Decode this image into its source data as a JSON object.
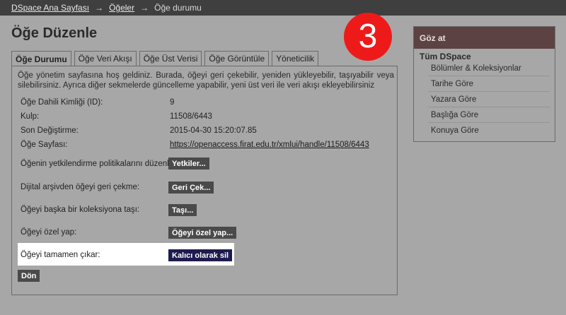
{
  "breadcrumb": {
    "home": "DSpace Ana Sayfası",
    "items": "Öğeler",
    "current": "Öğe durumu",
    "separator": "→"
  },
  "page_title": "Öğe Düzenle",
  "step_badge": "3",
  "tabs": [
    {
      "label": "Öğe Durumu",
      "active": true
    },
    {
      "label": "Öğe Veri Akışı"
    },
    {
      "label": "Öğe Üst Verisi"
    },
    {
      "label": "Öğe Görüntüle"
    },
    {
      "label": "Yöneticilik"
    }
  ],
  "intro": "Öğe yönetim sayfasına hoş geldiniz. Burada, öğeyi geri çekebilir, yeniden yükleyebilir, taşıyabilir veya silebilirsiniz. Ayrıca diğer sekmelerde güncelleme yapabilir, yeni üst veri ile veri akışı ekleyebilirsiniz",
  "fields": [
    {
      "label": "Öğe Dahili Kimliği (ID):",
      "value": "9"
    },
    {
      "label": "Kulp:",
      "value": "11508/6443"
    },
    {
      "label": "Son Değiştirme:",
      "value": "2015-04-30 15:20:07.85"
    },
    {
      "label": "Öğe Sayfası:",
      "value": "https://openaccess.firat.edu.tr/xmlui/handle/11508/6443"
    }
  ],
  "actions": [
    {
      "label": "Öğenin yetkilendirme politikalarını düzenle:",
      "button": "Yetkiler..."
    },
    {
      "label": "Dijital arşivden öğeyi geri çekme:",
      "button": "Geri Çek..."
    },
    {
      "label": "Öğeyi başka bir koleksiyona taşı:",
      "button": "Taşı..."
    },
    {
      "label": "Öğeyi özel yap:",
      "button": "Öğeyi özel yap..."
    },
    {
      "label": "Öğeyi tamamen çıkar:",
      "button": "Kalıcı olarak sil"
    }
  ],
  "return_button": "Dön",
  "sidebar": {
    "title": "Göz at",
    "section": "Tüm DSpace",
    "items": [
      "Bölümler & Koleksiyonlar",
      "Tarihe Göre",
      "Yazara Göre",
      "Başlığa Göre",
      "Konuya Göre"
    ]
  },
  "colors": {
    "background": "#a7a7a7",
    "topbar": "#3f3f3f",
    "sidebar_header": "#5c4242",
    "danger_button": "#1e1b4f",
    "badge": "#ee1a1a"
  }
}
